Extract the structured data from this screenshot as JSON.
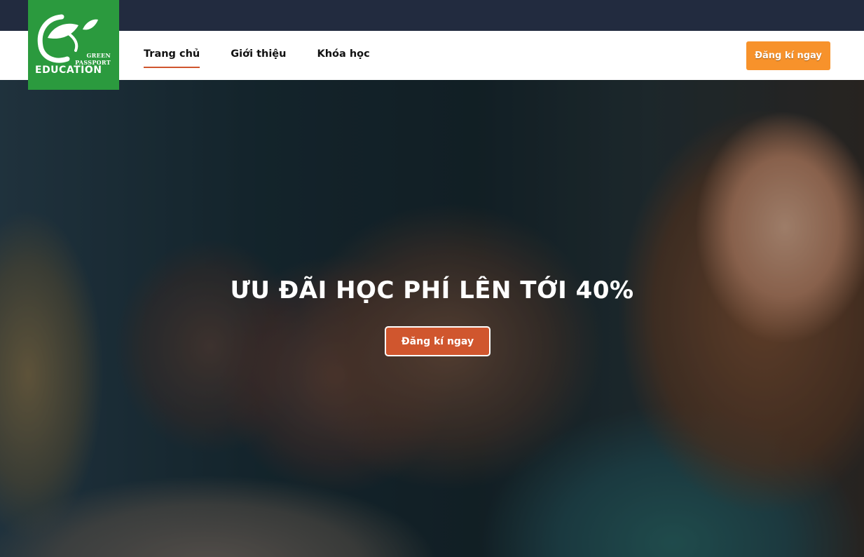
{
  "logo": {
    "line1": "GREEN",
    "line2": "PASSPORT",
    "line3": "EDUCATION",
    "icon": "leaf-logo-icon",
    "color": "#2b9a3e"
  },
  "nav": {
    "items": [
      {
        "label": "Trang chủ",
        "active": true
      },
      {
        "label": "Giới thiệu",
        "active": false
      },
      {
        "label": "Khóa học",
        "active": false
      }
    ],
    "cta_label": "Đăng kí ngay",
    "cta_color": "#f7922b"
  },
  "hero": {
    "title": "ƯU ĐÃI HỌC PHÍ LÊN TỚI 40%",
    "button_label": "Đăng kí ngay",
    "button_color": "#d0562e"
  }
}
